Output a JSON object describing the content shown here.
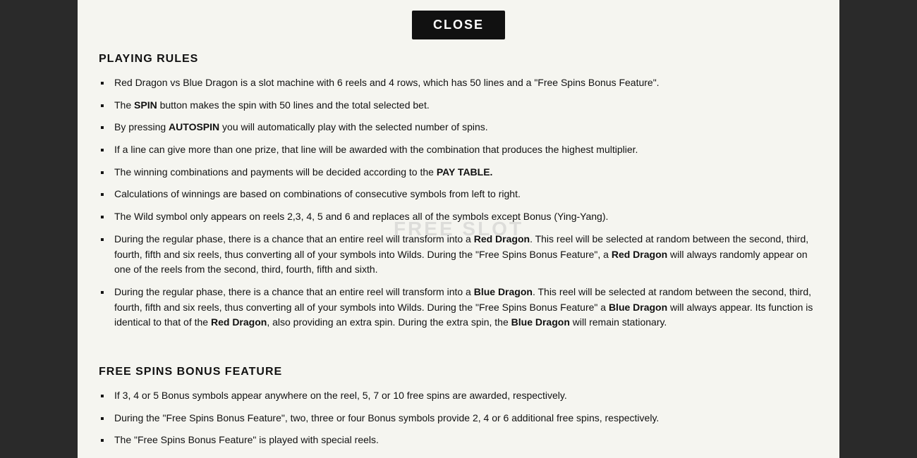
{
  "close_button": "CLOSE",
  "watermark": "FREE SLOT",
  "sections": {
    "playing_rules": {
      "title": "PLAYING RULES",
      "items": [
        {
          "text": "Red Dragon vs Blue Dragon is a slot machine with 6 reels and 4 rows, which has 50 lines and a \"Free Spins Bonus Feature\".",
          "bold_parts": []
        },
        {
          "text": "The SPIN button makes the spin with 50 lines and the total selected bet.",
          "bold_word": "SPIN"
        },
        {
          "text": "By pressing AUTOSPIN you will automatically play with the selected number of spins.",
          "bold_word": "AUTOSPIN"
        },
        {
          "text": "If a line can give more than one prize, that line will be awarded with the combination that produces the highest multiplier.",
          "bold_parts": []
        },
        {
          "text": "The winning combinations and payments will be decided according to the PAY TABLE.",
          "bold_end": "PAY TABLE."
        },
        {
          "text": "Calculations of winnings are based on combinations of consecutive symbols from left to right.",
          "bold_parts": []
        },
        {
          "text": "The Wild symbol only appears on reels 2,3, 4, 5 and 6 and replaces all of the symbols except Bonus (Ying-Yang).",
          "bold_parts": []
        },
        {
          "text": "During the regular phase, there is a chance that an entire reel will transform into a Red Dragon. This reel will be selected at random between the second, third, fourth, fifth and six reels, thus converting all of your symbols into Wilds. During the \"Free Spins Bonus Feature\", a Red Dragon will always randomly appear on one of the reels from the second, third, fourth, fifth and sixth.",
          "bold_words": [
            "Red Dragon",
            "Red Dragon"
          ]
        },
        {
          "text": "During the regular phase, there is a chance that an entire reel will transform into a Blue Dragon. This reel will be selected at random between the second, third, fourth, fifth and six reels, thus converting all of your symbols into Wilds. During the \"Free Spins Bonus Feature\" a Blue Dragon will always appear. Its function is identical to that of the Red Dragon, also providing an extra spin. During the extra spin, the Blue Dragon will remain stationary.",
          "bold_words": [
            "Blue Dragon",
            "Blue Dragon",
            "Red Dragon",
            "Blue Dragon"
          ]
        }
      ]
    },
    "free_spins": {
      "title": "FREE SPINS BONUS FEATURE",
      "items": [
        {
          "text": "If 3, 4 or 5 Bonus symbols appear anywhere on the reel, 5, 7 or 10 free spins are awarded, respectively.",
          "bold_parts": []
        },
        {
          "text": "During the \"Free Spins Bonus Feature\", two, three or four Bonus symbols provide 2, 4 or 6 additional free spins, respectively.",
          "bold_parts": []
        },
        {
          "text": "The \"Free Spins Bonus Feature\" is played with special reels.",
          "bold_parts": []
        }
      ]
    }
  }
}
